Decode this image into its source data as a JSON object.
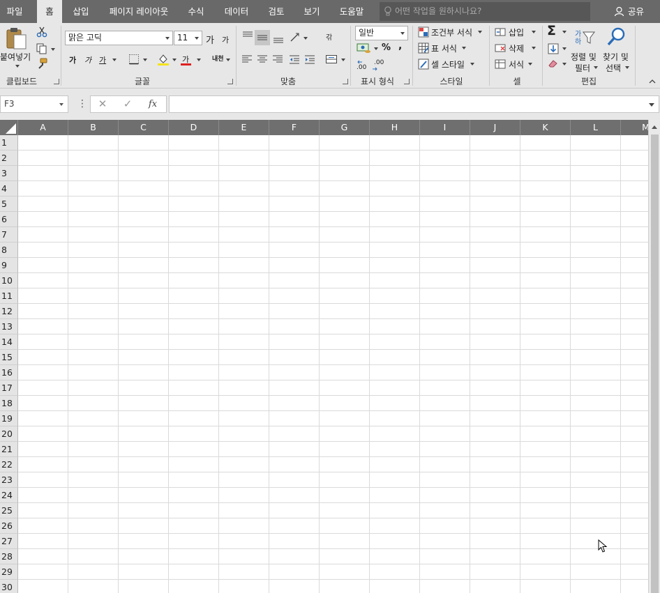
{
  "tabs": [
    {
      "label": "파일",
      "active": false
    },
    {
      "label": "홈",
      "active": true
    },
    {
      "label": "삽입",
      "active": false
    },
    {
      "label": "페이지 레이아웃",
      "active": false
    },
    {
      "label": "수식",
      "active": false
    },
    {
      "label": "데이터",
      "active": false
    },
    {
      "label": "검토",
      "active": false
    },
    {
      "label": "보기",
      "active": false
    },
    {
      "label": "도움말",
      "active": false
    }
  ],
  "tell_me": {
    "placeholder": "어떤 작업을 원하시나요?"
  },
  "share": {
    "label": "공유"
  },
  "ribbon": {
    "clipboard": {
      "paste_label": "붙여넣기",
      "group_label": "클립보드"
    },
    "font": {
      "font_name": "맑은 고딕",
      "font_size": "11",
      "grow_label": "가",
      "shrink_label": "가",
      "bold_label": "가",
      "italic_label": "가",
      "underline_label": "가",
      "font_color_label": "가",
      "phonetic_label": "내천",
      "group_label": "글꼴"
    },
    "alignment": {
      "wrap_label": "갂",
      "group_label": "맞춤"
    },
    "number": {
      "format": "일반",
      "percent_label": "%",
      "comma_label": ",",
      "inc_decimal": ".00",
      "dec_decimal": ".00",
      "group_label": "표시 형식"
    },
    "styles": {
      "conditional": "조건부 서식",
      "table": "표 서식",
      "cell_styles": "셀 스타일",
      "group_label": "스타일"
    },
    "cells": {
      "insert": "삽입",
      "delete": "삭제",
      "format": "서식",
      "group_label": "셀"
    },
    "editing": {
      "sort_filter_1": "정렬 및",
      "sort_filter_2": "필터",
      "find_select_1": "찾기 및",
      "find_select_2": "선택",
      "group_label": "편집"
    }
  },
  "formula_bar": {
    "name_box": "F3",
    "cancel": "✕",
    "enter": "✓",
    "fx": "fx",
    "value": ""
  },
  "columns": [
    "A",
    "B",
    "C",
    "D",
    "E",
    "F",
    "G",
    "H",
    "I",
    "J",
    "K",
    "L",
    "M"
  ],
  "rows": [
    "1",
    "2",
    "3",
    "4",
    "5",
    "6",
    "7",
    "8",
    "9",
    "10",
    "11",
    "12",
    "13",
    "14",
    "15",
    "16",
    "17",
    "18",
    "19",
    "20",
    "21",
    "22",
    "23",
    "24",
    "25",
    "26",
    "27",
    "28",
    "29",
    "30"
  ],
  "colors": {
    "tab_bar": "#696969",
    "ribbon": "#e7e7e7",
    "header": "#6f6f6f",
    "accent_blue": "#2b6cb8"
  }
}
